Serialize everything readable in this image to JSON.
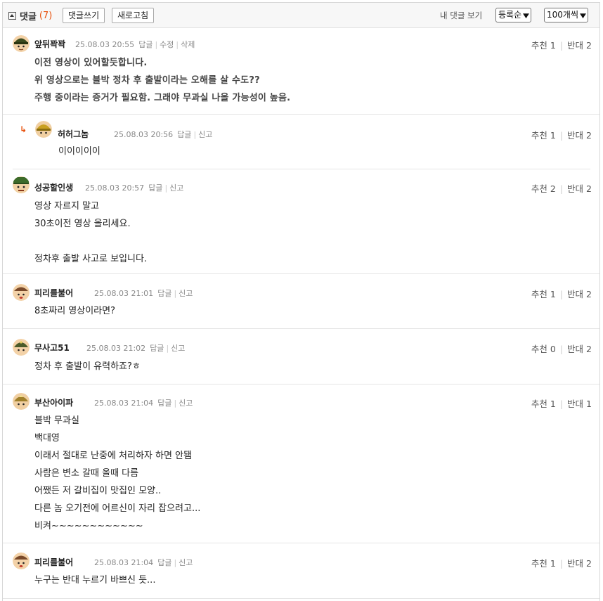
{
  "header": {
    "title": "댓글",
    "count": "(7)",
    "write_button": "댓글쓰기",
    "refresh_button": "새로고침",
    "my_comments": "내 댓글 보기",
    "sort_select": "등록순",
    "per_page_select": "100개씩"
  },
  "labels": {
    "reply": "답글",
    "edit": "수정",
    "delete": "삭제",
    "report": "신고",
    "up": "추천",
    "down": "반대"
  },
  "comments": [
    {
      "nick": "앞뒤꽉꽉",
      "time": "25.08.03 20:55",
      "up": "1",
      "down": "2",
      "lines": [
        "이전 영상이 있어할듯합니다.",
        "위 영상으로는 블박 정차 후 출발이라는 오해를 살 수도??",
        "주행 중이라는 증거가 필요함. 그래야 무과실 나올 가능성이 높음."
      ]
    },
    {
      "nick": "허허그놈",
      "time": "25.08.03 20:56",
      "up": "1",
      "down": "2",
      "lines": [
        "이이이이이"
      ]
    },
    {
      "nick": "성공할인생",
      "time": "25.08.03 20:57",
      "up": "2",
      "down": "2",
      "lines": [
        "영상 자르지 말고",
        "30초이전 영상 올리세요.",
        "",
        "정차후 출발 사고로 보입니다."
      ]
    },
    {
      "nick": "피리를불어",
      "time": "25.08.03 21:01",
      "up": "1",
      "down": "2",
      "lines": [
        "8초짜리 영상이라면?"
      ]
    },
    {
      "nick": "무사고51",
      "time": "25.08.03 21:02",
      "up": "0",
      "down": "2",
      "lines": [
        "정차 후 출발이 유력하죠?ㅎ"
      ]
    },
    {
      "nick": "부산아이파",
      "time": "25.08.03 21:04",
      "up": "1",
      "down": "1",
      "lines": [
        "블박 무과실",
        "백대영",
        "이래서 절대로 난중에 처리하자 하면 안됌",
        "사람은 변소 갈때 올때 다름",
        "어쨌든 저 갈비집이 맛집인 모양..",
        "다른 놈 오기전에 어르신이 자리 잡으려고...",
        "비켜~~~~~~~~~~~~"
      ]
    },
    {
      "nick": "피리를불어",
      "time": "25.08.03 21:04",
      "up": "1",
      "down": "2",
      "lines": [
        "누구는 반대 누르기 바쁘신 듯..."
      ]
    }
  ],
  "colors": {
    "accent": "#e8500b",
    "text": "#222222",
    "meta": "#888888",
    "border": "#e5e5e5"
  }
}
